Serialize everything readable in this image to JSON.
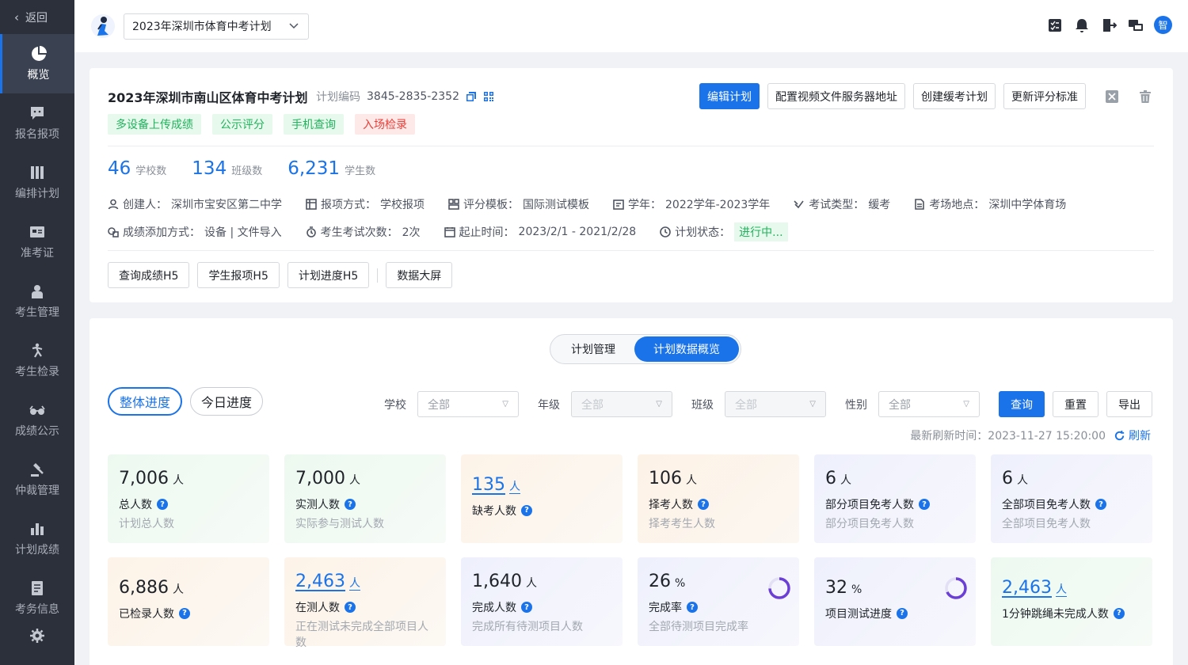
{
  "sidebar": {
    "back_label": "返回",
    "items": [
      {
        "label": "概览",
        "icon": "pie-chart-icon",
        "active": true
      },
      {
        "label": "报名报项",
        "icon": "chat-icon"
      },
      {
        "label": "编排计划",
        "icon": "columns-icon"
      },
      {
        "label": "准考证",
        "icon": "id-card-icon"
      },
      {
        "label": "考生管理",
        "icon": "student-icon"
      },
      {
        "label": "考生检录",
        "icon": "runner-icon"
      },
      {
        "label": "成绩公示",
        "icon": "glasses-icon"
      },
      {
        "label": "仲裁管理",
        "icon": "gavel-icon"
      },
      {
        "label": "计划成绩",
        "icon": "bar-chart-icon"
      },
      {
        "label": "考务信息",
        "icon": "document-icon"
      }
    ]
  },
  "topbar": {
    "plan_select_value": "2023年深圳市体育中考计划",
    "avatar_text": "智"
  },
  "plan": {
    "title": "2023年深圳市南山区体育中考计划",
    "code_label": "计划编码",
    "code_value": "3845-2835-2352",
    "tags": [
      "多设备上传成绩",
      "公示评分",
      "手机查询",
      "入场检录"
    ],
    "actions": {
      "edit": "编辑计划",
      "video_server": "配置视频文件服务器地址",
      "create_deferred": "创建缓考计划",
      "update_standard": "更新评分标准"
    },
    "stats": [
      {
        "value": "46",
        "label": "学校数"
      },
      {
        "value": "134",
        "label": "班级数"
      },
      {
        "value": "6,231",
        "label": "学生数"
      }
    ],
    "meta_row1": [
      {
        "label": "创建人：",
        "value": "深圳市宝安区第二中学"
      },
      {
        "label": "报项方式：",
        "value": "学校报项"
      },
      {
        "label": "评分模板：",
        "value": "国际测试模板"
      },
      {
        "label": "学年：",
        "value": "2022学年-2023学年"
      },
      {
        "label": "考试类型：",
        "value": "缓考"
      },
      {
        "label": "考场地点：",
        "value": "深圳中学体育场"
      }
    ],
    "meta_row2": [
      {
        "label": "成绩添加方式：",
        "value": "设备 | 文件导入"
      },
      {
        "label": "考生考试次数：",
        "value": "2次"
      },
      {
        "label": "起止时间：",
        "value": "2023/2/1 - 2021/2/28"
      },
      {
        "label": "计划状态：",
        "value": "进行中..."
      }
    ],
    "h5_buttons": [
      "查询成绩H5",
      "学生报项H5",
      "计划进度H5",
      "数据大屏"
    ]
  },
  "overview": {
    "segments": [
      "计划管理",
      "计划数据概览"
    ],
    "progress_tabs": [
      "整体进度",
      "今日进度"
    ],
    "filters": [
      {
        "label": "学校",
        "value": "全部",
        "disabled": false
      },
      {
        "label": "年级",
        "value": "全部",
        "disabled": true
      },
      {
        "label": "班级",
        "value": "全部",
        "disabled": true
      },
      {
        "label": "性别",
        "value": "全部",
        "disabled": false
      }
    ],
    "buttons": {
      "query": "查询",
      "reset": "重置",
      "export": "导出"
    },
    "refresh_time_label": "最新刷新时间：",
    "refresh_time": "2023-11-27 15:20:00",
    "refresh_label": "刷新",
    "cards": [
      {
        "value": "7,006",
        "unit": "人",
        "name": "总人数",
        "desc": "计划总人数",
        "bg": "green"
      },
      {
        "value": "7,000",
        "unit": "人",
        "name": "实测人数",
        "desc": "实际参与测试人数",
        "bg": "green"
      },
      {
        "value": "135",
        "unit": "人",
        "name": "缺考人数",
        "desc": "",
        "bg": "orange",
        "link": true
      },
      {
        "value": "106",
        "unit": "人",
        "name": "择考人数",
        "desc": "择考考生人数",
        "bg": "peach"
      },
      {
        "value": "6",
        "unit": "人",
        "name": "部分项目免考人数",
        "desc": "部分项目免考人数",
        "bg": "purple"
      },
      {
        "value": "6",
        "unit": "人",
        "name": "全部项目免考人数",
        "desc": "全部项目免考人数",
        "bg": "purple"
      },
      {
        "value": "6,886",
        "unit": "人",
        "name": "已检录人数",
        "desc": "",
        "bg": "orange"
      },
      {
        "value": "2,463",
        "unit": "人",
        "name": "在测人数",
        "desc": "正在测试未完成全部项目人数",
        "bg": "orange",
        "link": true
      },
      {
        "value": "1,640",
        "unit": "人",
        "name": "完成人数",
        "desc": "完成所有待测项目人数",
        "bg": "purple"
      },
      {
        "value": "26",
        "unit": "%",
        "name": "完成率",
        "desc": "全部待测项目完成率",
        "bg": "purple",
        "ring": 0.26
      },
      {
        "value": "32",
        "unit": "%",
        "name": "项目测试进度",
        "desc": "",
        "bg": "purple",
        "ring": 0.32
      },
      {
        "value": "2,463",
        "unit": "人",
        "name": "1分钟跳绳未完成人数",
        "desc": "",
        "bg": "green",
        "link": true
      }
    ]
  },
  "colors": {
    "accent": "#1a73e8",
    "success": "#23b25e",
    "danger": "#e5403a",
    "ring": "#6b3fd6"
  }
}
